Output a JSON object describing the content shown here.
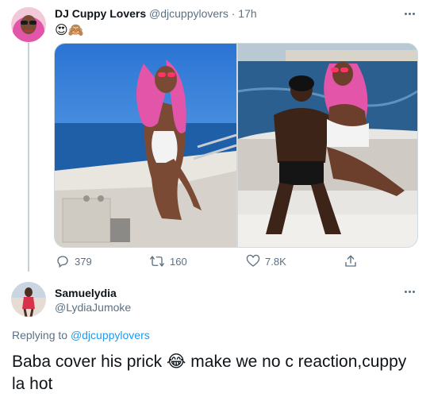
{
  "tweet": {
    "display_name": "DJ Cuppy Lovers",
    "handle": "@djcuppylovers",
    "separator": "·",
    "time": "17h",
    "text": "😍🙈",
    "stats": {
      "replies": "379",
      "retweets": "160",
      "likes": "7.8K"
    }
  },
  "reply": {
    "display_name": "Samuelydia",
    "handle": "@LydiaJumoke",
    "replying_prefix": "Replying to",
    "replying_to": "@djcuppylovers",
    "text": "Baba cover his prick 😂 make we no c reaction,cuppy la hot"
  },
  "icons": {
    "reply": "reply-icon",
    "retweet": "retweet-icon",
    "like": "heart-icon",
    "share": "share-icon",
    "more": "more-options-icon"
  },
  "colors": {
    "accent": "#1d9bf0",
    "muted": "#5b7083",
    "hair": "#e255a8",
    "sky": "#2f7fd6"
  }
}
